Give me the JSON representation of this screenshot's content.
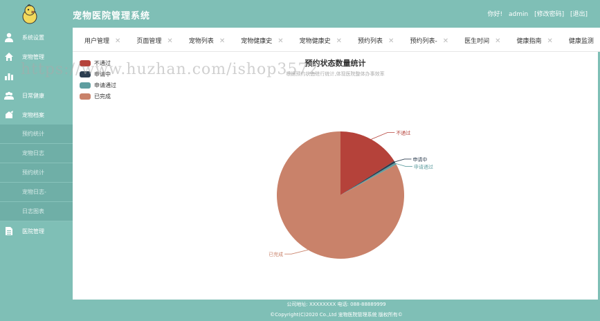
{
  "header": {
    "title": "宠物医院管理系统",
    "greeting": "你好!",
    "user": "admin",
    "change_password": "[修改密码]",
    "logout": "[退出]"
  },
  "sidebar": {
    "items": [
      {
        "label": "系统设置",
        "icon": "user-icon"
      },
      {
        "label": "宠物管理",
        "icon": "home-icon"
      },
      {
        "label": "",
        "icon": "bar-chart-icon"
      },
      {
        "label": "日常健康",
        "icon": "group-icon"
      },
      {
        "label": "宠物档案",
        "icon": "pet-icon"
      }
    ],
    "subitems": [
      "预约统计",
      "宠物日志",
      "预约统计",
      "宠物日志-",
      "日志图表"
    ],
    "last_item": {
      "label": "医院管理",
      "icon": "document-icon"
    }
  },
  "tabs": [
    "用户管理",
    "页面管理",
    "宠物列表",
    "宠物健康史",
    "宠物健康史",
    "预约列表",
    "预约列表-",
    "医生时间",
    "健康指南",
    "健康监测"
  ],
  "chart_data": {
    "type": "pie",
    "title": "预约状态数量统计",
    "subtitle": "根据预约状态进行统计,体现医院整体办事效率",
    "legend_position": "top-left",
    "categories": [
      "不通过",
      "申请中",
      "申请通过",
      "已完成"
    ],
    "values": [
      16,
      0.5,
      0.5,
      83
    ],
    "colors": [
      "#b5423a",
      "#2c3e50",
      "#5f9ea0",
      "#c9826a"
    ]
  },
  "watermark": "https://www.huzhan.com/ishop3572",
  "footer": {
    "address": "公司地址: XXXXXXXX 电话: 088-88889999",
    "copyright": "©Copyright(C)2020 Co.,Ltd 宠物医院管理系统 版权所有©"
  }
}
